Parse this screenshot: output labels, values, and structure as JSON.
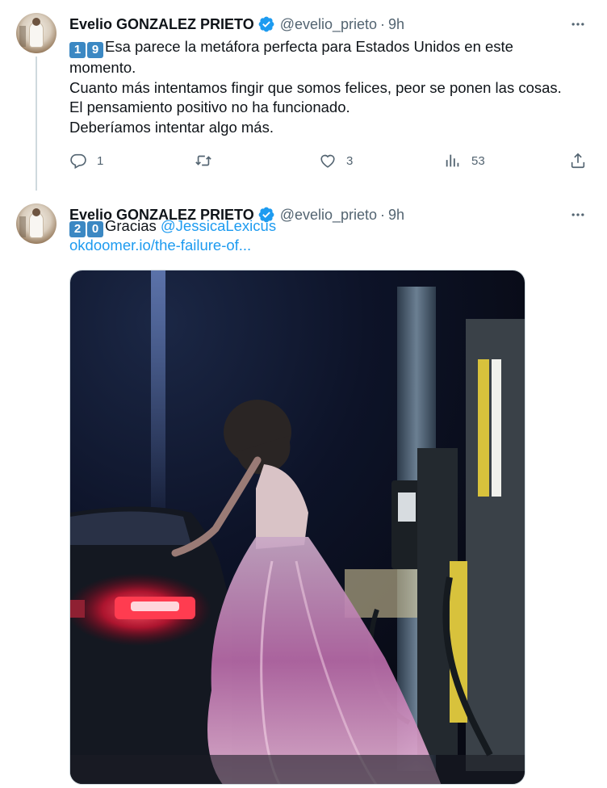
{
  "tweets": [
    {
      "author_name": "Evelio GONZALEZ PRIETO",
      "handle": "@evelio_prieto",
      "separator": "·",
      "time": "9h",
      "keycaps": [
        "1",
        "9"
      ],
      "lines": [
        "Esa parece la metáfora perfecta para Estados Unidos en este",
        "momento.",
        "Cuanto más intentamos fingir que somos felices, peor se ponen las cosas.",
        "El pensamiento positivo no ha funcionado.",
        "Deberíamos intentar algo más."
      ],
      "actions": {
        "reply_count": "1",
        "retweet_count": "",
        "like_count": "3",
        "views_count": "53"
      }
    },
    {
      "author_name": "Evelio GONZALEZ PRIETO",
      "handle": "@evelio_prieto",
      "separator": "·",
      "time": "9h",
      "keycaps": [
        "2",
        "0"
      ],
      "text_prefix": "Gracias ",
      "mention": "@JessicaLexicus",
      "link": "okdoomer.io/the-failure-of..."
    }
  ],
  "colors": {
    "accent": "#1d9bf0",
    "secondary_text": "#536471",
    "thread_line": "#cfd9de",
    "keycap": "#3b88c3"
  },
  "icons": [
    "verified-badge-icon",
    "more-options-icon",
    "reply-icon",
    "retweet-icon",
    "like-icon",
    "views-icon",
    "share-icon"
  ]
}
